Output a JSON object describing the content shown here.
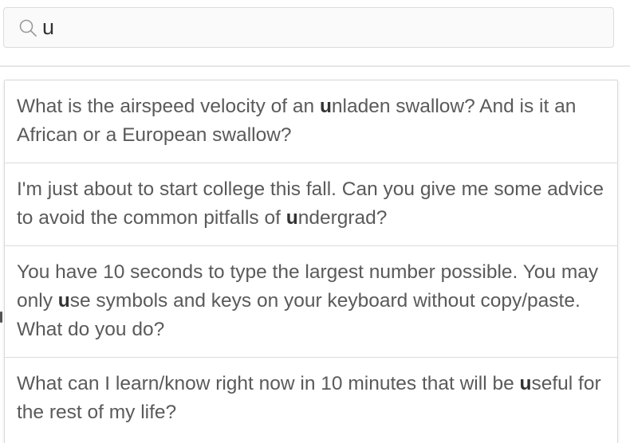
{
  "search": {
    "value": "u",
    "icon": "search-icon"
  },
  "suggestions": [
    {
      "pre": "What is the airspeed velocity of an ",
      "match": "u",
      "post": "nladen swallow? And is it an African or a European swallow?"
    },
    {
      "pre": "I'm just about to start college this fall. Can you give me some advice to avoid the common pitfalls of ",
      "match": "u",
      "post": "ndergrad?"
    },
    {
      "pre": "You have 10 seconds to type the largest number possible. You may only ",
      "match": "u",
      "post": "se symbols and keys on your keyboard without copy/paste. What do you do?"
    },
    {
      "pre": "What can I learn/know right now in 10 minutes that will be ",
      "match": "u",
      "post": "seful for the rest of my life?"
    }
  ],
  "colors": {
    "text": "#5a5a5a",
    "highlight": "#333333",
    "border": "#dcdcdc"
  }
}
